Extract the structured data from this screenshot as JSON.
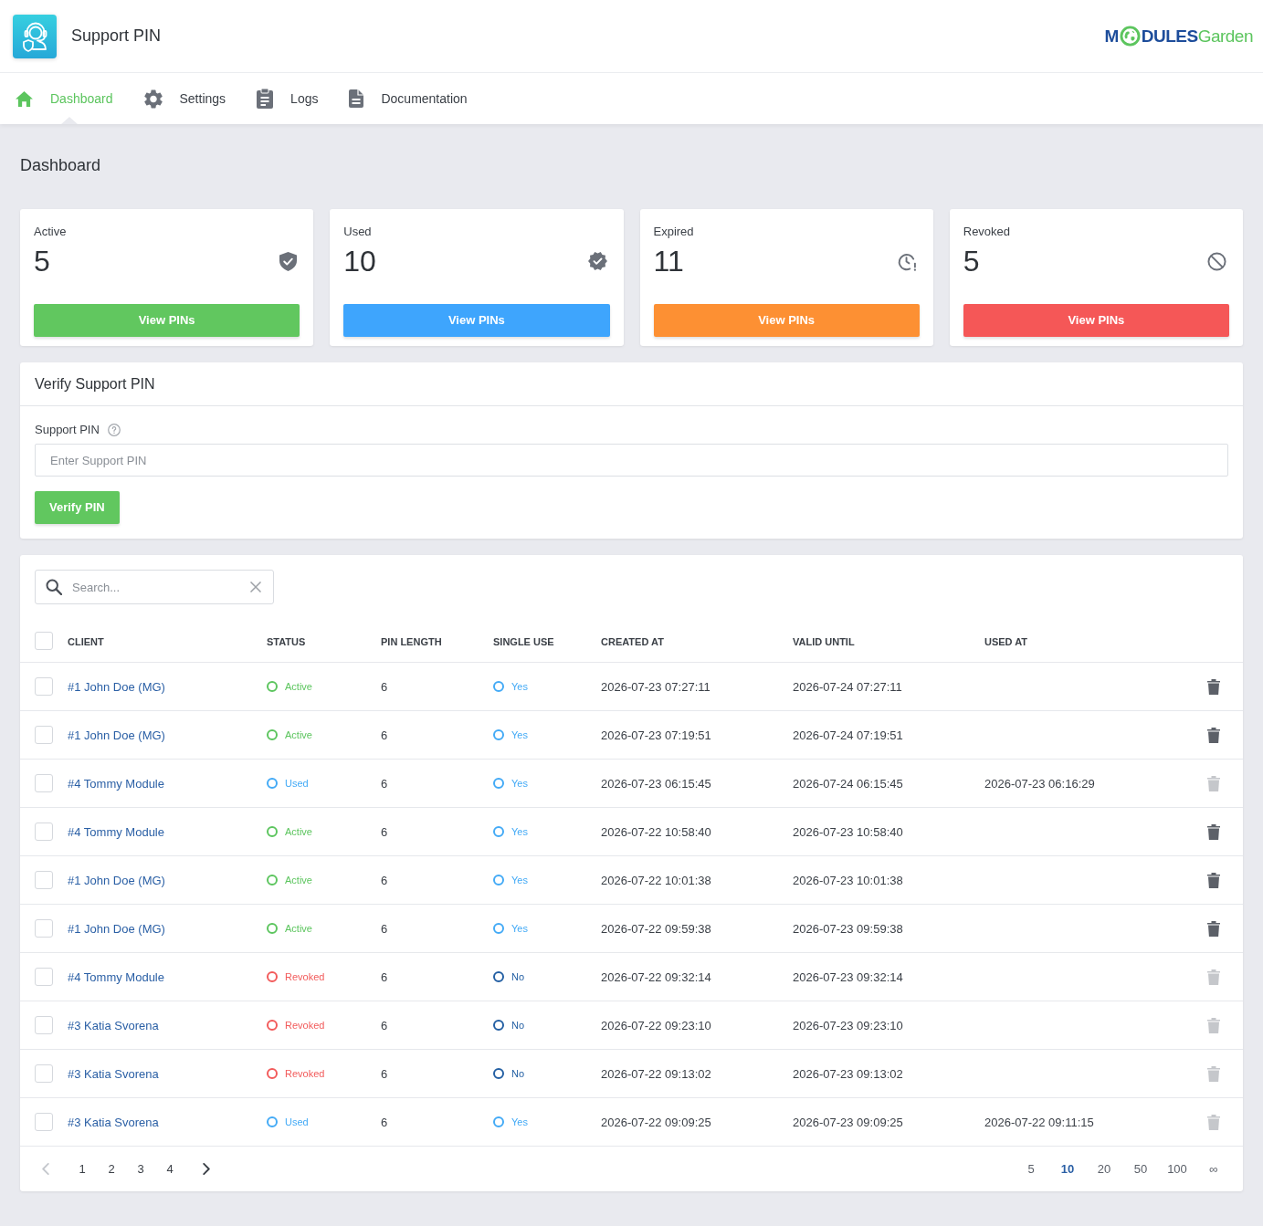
{
  "header": {
    "title": "Support PIN",
    "logo": {
      "lead": "M",
      "tail": "**DULES**Garden"
    }
  },
  "nav": [
    {
      "label": "Dashboard",
      "selected": true
    },
    {
      "label": "Settings",
      "selected": false
    },
    {
      "label": "Logs",
      "selected": false
    },
    {
      "label": "Documentation",
      "selected": false
    }
  ],
  "page_title": "Dashboard",
  "stat_cards": [
    {
      "label": "Active",
      "value": "5",
      "button": "View PINs",
      "color": "#61c75f"
    },
    {
      "label": "Used",
      "value": "10",
      "button": "View PINs",
      "color": "#3ea5fd"
    },
    {
      "label": "Expired",
      "value": "11",
      "button": "View PINs",
      "color": "#fd9033"
    },
    {
      "label": "Revoked",
      "value": "5",
      "button": "View PINs",
      "color": "#f55757"
    }
  ],
  "verify": {
    "title": "Verify Support PIN",
    "field_label": "Support PIN",
    "placeholder": "Enter Support PIN",
    "button": "Verify PIN"
  },
  "table": {
    "search_placeholder": "Search...",
    "select_all_checked": false,
    "columns": [
      "CLIENT",
      "STATUS",
      "PIN LENGTH",
      "SINGLE USE",
      "CREATED AT",
      "VALID UNTIL",
      "USED AT"
    ],
    "rows": [
      {
        "checked": false,
        "client": "#1 John Doe (MG)",
        "status": {
          "label": "Active",
          "color": "#5cc55e"
        },
        "pin_length": "6",
        "single_use": {
          "label": "Yes",
          "color": "#43aaf6"
        },
        "created_at": "2026-07-23 07:27:11",
        "valid_until": "2026-07-24 07:27:11",
        "delete_disabled": false
      },
      {
        "checked": false,
        "client": "#1 John Doe (MG)",
        "status": {
          "label": "Active",
          "color": "#5cc55e"
        },
        "pin_length": "6",
        "single_use": {
          "label": "Yes",
          "color": "#43aaf6"
        },
        "created_at": "2026-07-23 07:19:51",
        "valid_until": "2026-07-24 07:19:51",
        "delete_disabled": false
      },
      {
        "checked": false,
        "client": "#4 Tommy Module",
        "status": {
          "label": "Used",
          "color": "#43aaf6"
        },
        "pin_length": "6",
        "single_use": {
          "label": "Yes",
          "color": "#43aaf6"
        },
        "created_at": "2026-07-23 06:15:45",
        "valid_until": "2026-07-24 06:15:45",
        "used_at": "2026-07-23 06:16:29",
        "delete_disabled": true
      },
      {
        "checked": false,
        "client": "#4 Tommy Module",
        "status": {
          "label": "Active",
          "color": "#5cc55e"
        },
        "pin_length": "6",
        "single_use": {
          "label": "Yes",
          "color": "#43aaf6"
        },
        "created_at": "2026-07-22 10:58:40",
        "valid_until": "2026-07-23 10:58:40",
        "delete_disabled": false
      },
      {
        "checked": false,
        "client": "#1 John Doe (MG)",
        "status": {
          "label": "Active",
          "color": "#5cc55e"
        },
        "pin_length": "6",
        "single_use": {
          "label": "Yes",
          "color": "#43aaf6"
        },
        "created_at": "2026-07-22 10:01:38",
        "valid_until": "2026-07-23 10:01:38",
        "delete_disabled": false
      },
      {
        "checked": false,
        "client": "#1 John Doe (MG)",
        "status": {
          "label": "Active",
          "color": "#5cc55e"
        },
        "pin_length": "6",
        "single_use": {
          "label": "Yes",
          "color": "#43aaf6"
        },
        "created_at": "2026-07-22 09:59:38",
        "valid_until": "2026-07-23 09:59:38",
        "delete_disabled": false
      },
      {
        "checked": false,
        "client": "#4 Tommy Module",
        "status": {
          "label": "Revoked",
          "color": "#f25a5a"
        },
        "pin_length": "6",
        "single_use": {
          "label": "No",
          "color": "#235fa3"
        },
        "created_at": "2026-07-22 09:32:14",
        "valid_until": "2026-07-23 09:32:14",
        "delete_disabled": true
      },
      {
        "checked": false,
        "client": "#3 Katia Svorena",
        "status": {
          "label": "Revoked",
          "color": "#f25a5a"
        },
        "pin_length": "6",
        "single_use": {
          "label": "No",
          "color": "#235fa3"
        },
        "created_at": "2026-07-22 09:23:10",
        "valid_until": "2026-07-23 09:23:10",
        "delete_disabled": true
      },
      {
        "checked": false,
        "client": "#3 Katia Svorena",
        "status": {
          "label": "Revoked",
          "color": "#f25a5a"
        },
        "pin_length": "6",
        "single_use": {
          "label": "No",
          "color": "#235fa3"
        },
        "created_at": "2026-07-22 09:13:02",
        "valid_until": "2026-07-23 09:13:02",
        "delete_disabled": true
      },
      {
        "checked": false,
        "client": "#3 Katia Svorena",
        "status": {
          "label": "Used",
          "color": "#43aaf6"
        },
        "pin_length": "6",
        "single_use": {
          "label": "Yes",
          "color": "#43aaf6"
        },
        "created_at": "2026-07-22 09:09:25",
        "valid_until": "2026-07-23 09:09:25",
        "used_at": "2026-07-22 09:11:15",
        "delete_disabled": true
      }
    ]
  },
  "pagination": {
    "prev_disabled": true,
    "next_disabled": false,
    "pages": [
      {
        "label": "1",
        "selected": false
      },
      {
        "label": "2",
        "selected": false
      },
      {
        "label": "3",
        "selected": false
      },
      {
        "label": "4",
        "selected": false
      }
    ],
    "page_sizes": [
      {
        "label": "5",
        "selected": false
      },
      {
        "label": "10",
        "selected": true
      },
      {
        "label": "20",
        "selected": false
      },
      {
        "label": "50",
        "selected": false
      },
      {
        "label": "100",
        "selected": false
      },
      {
        "label": "∞",
        "selected": false
      }
    ]
  }
}
